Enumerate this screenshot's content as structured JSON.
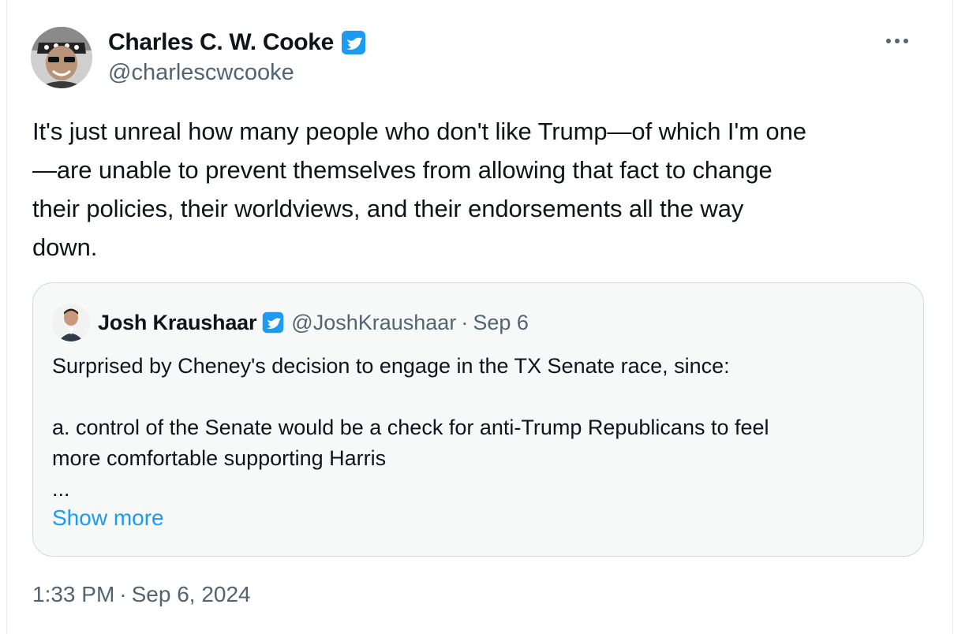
{
  "tweet": {
    "author": {
      "display_name": "Charles C. W. Cooke",
      "handle": "@charlescwcooke",
      "verified_icon": "verified-badge-icon"
    },
    "more_icon": "more-options-icon",
    "text": "It's just unreal how many people who don't like Trump—of which I'm one\n—are unable to prevent themselves from allowing that fact to change\ntheir policies, their worldviews, and their endorsements all the way\ndown.",
    "time": "1:33 PM",
    "separator": "·",
    "date": "Sep 6, 2024"
  },
  "quote": {
    "author": {
      "display_name": "Josh Kraushaar",
      "handle": "@JoshKraushaar",
      "verified_icon": "verified-badge-icon"
    },
    "separator": "·",
    "date": "Sep 6",
    "text": "Surprised by Cheney's decision to engage in the TX Senate race, since:\n\na. control of the Senate would be a check for anti-Trump Republicans to feel\nmore comfortable supporting Harris\n...",
    "show_more_label": "Show more"
  },
  "colors": {
    "accent": "#1d9bf0",
    "secondary_text": "#536471",
    "primary_text": "#0f1419",
    "quote_border": "#cfd9de"
  }
}
